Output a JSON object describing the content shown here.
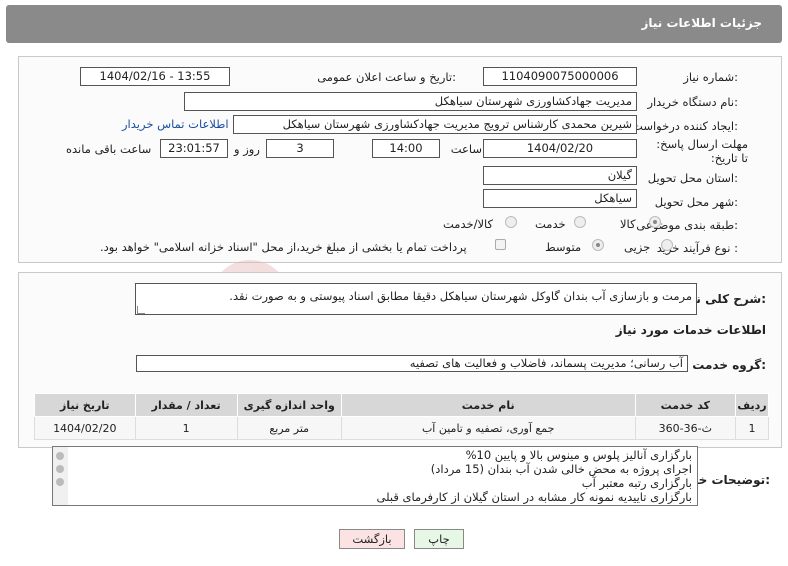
{
  "header": {
    "title": "جزئیات اطلاعات نیاز"
  },
  "fields": {
    "need_number_label": "شماره نیاز:",
    "need_number": "1104090075000006",
    "announce_label": "تاریخ و ساعت اعلان عمومی:",
    "announce_value": "1404/02/16 - 13:55",
    "buyer_org_label": "نام دستگاه خریدار:",
    "buyer_org": "مدیریت جهادکشاورزی شهرستان سیاهکل",
    "creator_label": "ایجاد کننده درخواست:",
    "creator": "شیرین محمدی کارشناس ترویج مدیریت جهادکشاورزی شهرستان سیاهکل",
    "contact_link": "اطلاعات تماس خریدار",
    "deadline_label": "مهلت ارسال پاسخ: تا تاریخ:",
    "deadline_date": "1404/02/20",
    "time_label": "ساعت",
    "deadline_time": "14:00",
    "days_count": "3",
    "days_label": "روز و",
    "remaining_time": "23:01:57",
    "remaining_label": "ساعت باقی مانده",
    "province_label": "استان محل تحویل:",
    "province": "گیلان",
    "city_label": "شهر محل تحویل:",
    "city": "سیاهکل",
    "category_label": "طبقه بندی موضوعی:",
    "category_options": [
      "کالا",
      "خدمت",
      "کالا/خدمت"
    ],
    "process_label": "نوع فرآیند خرید :",
    "process_options": [
      "جزیی",
      "متوسط"
    ],
    "payment_note": "پرداخت تمام یا بخشی از مبلغ خرید،از محل \"اسناد خزانه اسلامی\" خواهد بود."
  },
  "description": {
    "label": "شرح کلی نیاز:",
    "text": "مرمت و بازسازی آب بندان گاوکل شهرستان سیاهکل دقیقا مطابق اسناد پیوستی و به صورت نقد."
  },
  "services": {
    "section_title": "اطلاعات خدمات مورد نیاز",
    "group_label": "گروه خدمت:",
    "group_value": "آب رسانی؛ مدیریت پسماند، فاضلاب و فعالیت های تصفیه",
    "columns": [
      "ردیف",
      "کد خدمت",
      "نام خدمت",
      "واحد اندازه گیری",
      "تعداد / مقدار",
      "تاریخ نیاز"
    ],
    "rows": [
      {
        "row": "1",
        "code": "ث-36-360",
        "name": "جمع آوری، تصفیه و تامین آب",
        "unit": "متر مربع",
        "qty": "1",
        "date": "1404/02/20"
      }
    ]
  },
  "buyer_notes": {
    "label": "توضیحات خریدار:",
    "lines": [
      "بارگزاری آنالیز پلوس و مینوس بالا و پایین 10%",
      "اجرای پروژه به محض خالی شدن آب بندان (15 مرداد)",
      "بارگزاری رتبه معتبر آب",
      "بارگزاری تاییدیه نمونه کار مشابه در استان گیلان از کارفرمای قبلی"
    ]
  },
  "buttons": {
    "print": "چاپ",
    "back": "بازگشت"
  },
  "colors": {
    "header_bg": "#8a8a8a",
    "link": "#1a4fa0",
    "back_bg": "#fbe3e3",
    "print_bg": "#e6f7e6"
  }
}
